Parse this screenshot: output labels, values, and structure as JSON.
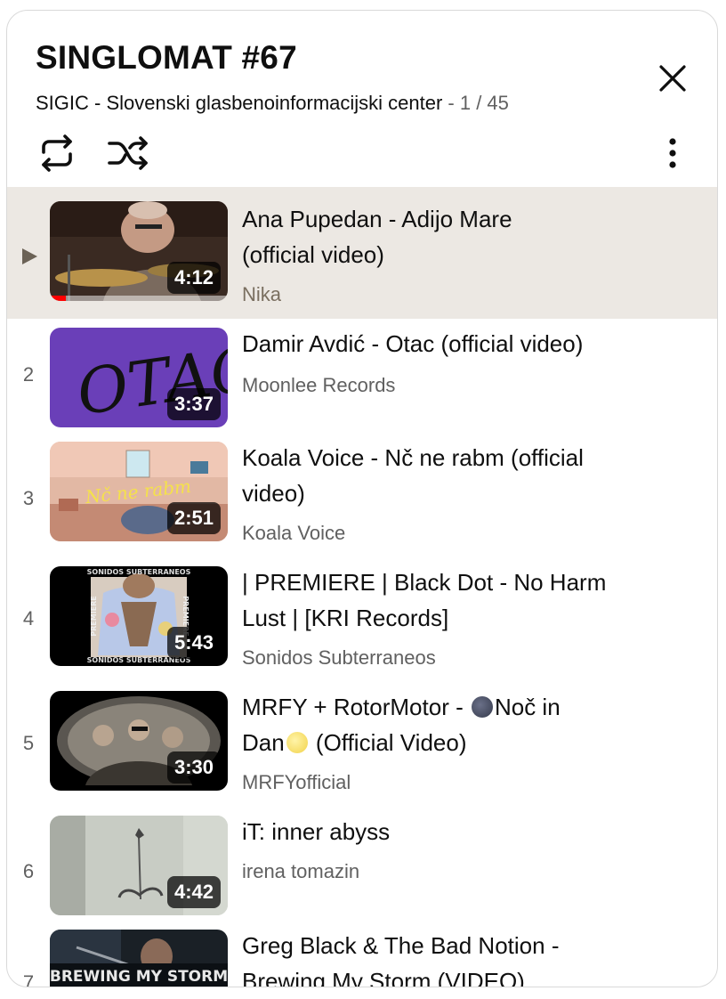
{
  "playlist": {
    "title": "SINGLOMAT #67",
    "owner": "SIGIC - Slovenski glasbenoinformacijski center",
    "separator": " - ",
    "position": "1 / 45"
  },
  "icons": {
    "close": "close-icon",
    "loop": "loop-icon",
    "shuffle": "shuffle-icon",
    "more": "more-vert-icon",
    "now_playing": "play-arrow-icon"
  },
  "colors": {
    "active_row": "#ece8e3",
    "progress": "#ff0000",
    "secondary_text": "#606060"
  },
  "videos": [
    {
      "index": "▶",
      "active": true,
      "title_line1": "Ana Pupedan - Adijo Mare",
      "title_line2": "(official video)",
      "channel": "Nika",
      "duration": "4:12",
      "watched_fraction": 0.09
    },
    {
      "index": "2",
      "title_line1": "Damir Avdić - Otac (official video)",
      "channel": "Moonlee Records",
      "duration": "3:37",
      "thumb_text": "OTAC"
    },
    {
      "index": "3",
      "title_line1": "Koala Voice - Nč ne rabm (official",
      "title_line2": "video)",
      "channel": "Koala Voice",
      "duration": "2:51",
      "thumb_text": "Nč ne rabm"
    },
    {
      "index": "4",
      "title_line1": "| PREMIERE | Black Dot - No Harm",
      "title_line2": "Lust | [KRI Records]",
      "channel": "Sonidos Subterraneos",
      "duration": "5:43",
      "thumb_text_top": "SONIDOS SUBTERRANEOS",
      "thumb_text_bottom": "SONIDOS SUBTERRANEOS",
      "thumb_text_side_left": "PREMIERE",
      "thumb_text_side_right": "PREMIERE"
    },
    {
      "index": "5",
      "title_line1_a": "MRFY + RotorMotor - ",
      "title_line1_b": "Noč in",
      "title_line2_a": "Dan",
      "title_line2_b": " (Official Video)",
      "channel": "MRFYofficial",
      "duration": "3:30"
    },
    {
      "index": "6",
      "title_line1": "iT: inner abyss",
      "channel": "irena tomazin",
      "duration": "4:42"
    },
    {
      "index": "7",
      "title_line1": "Greg Black & The Bad Notion -",
      "title_line2": "Brewing My Storm (VIDEO)",
      "channel": "",
      "duration": "",
      "thumb_text": "BREWING MY STORM"
    }
  ]
}
